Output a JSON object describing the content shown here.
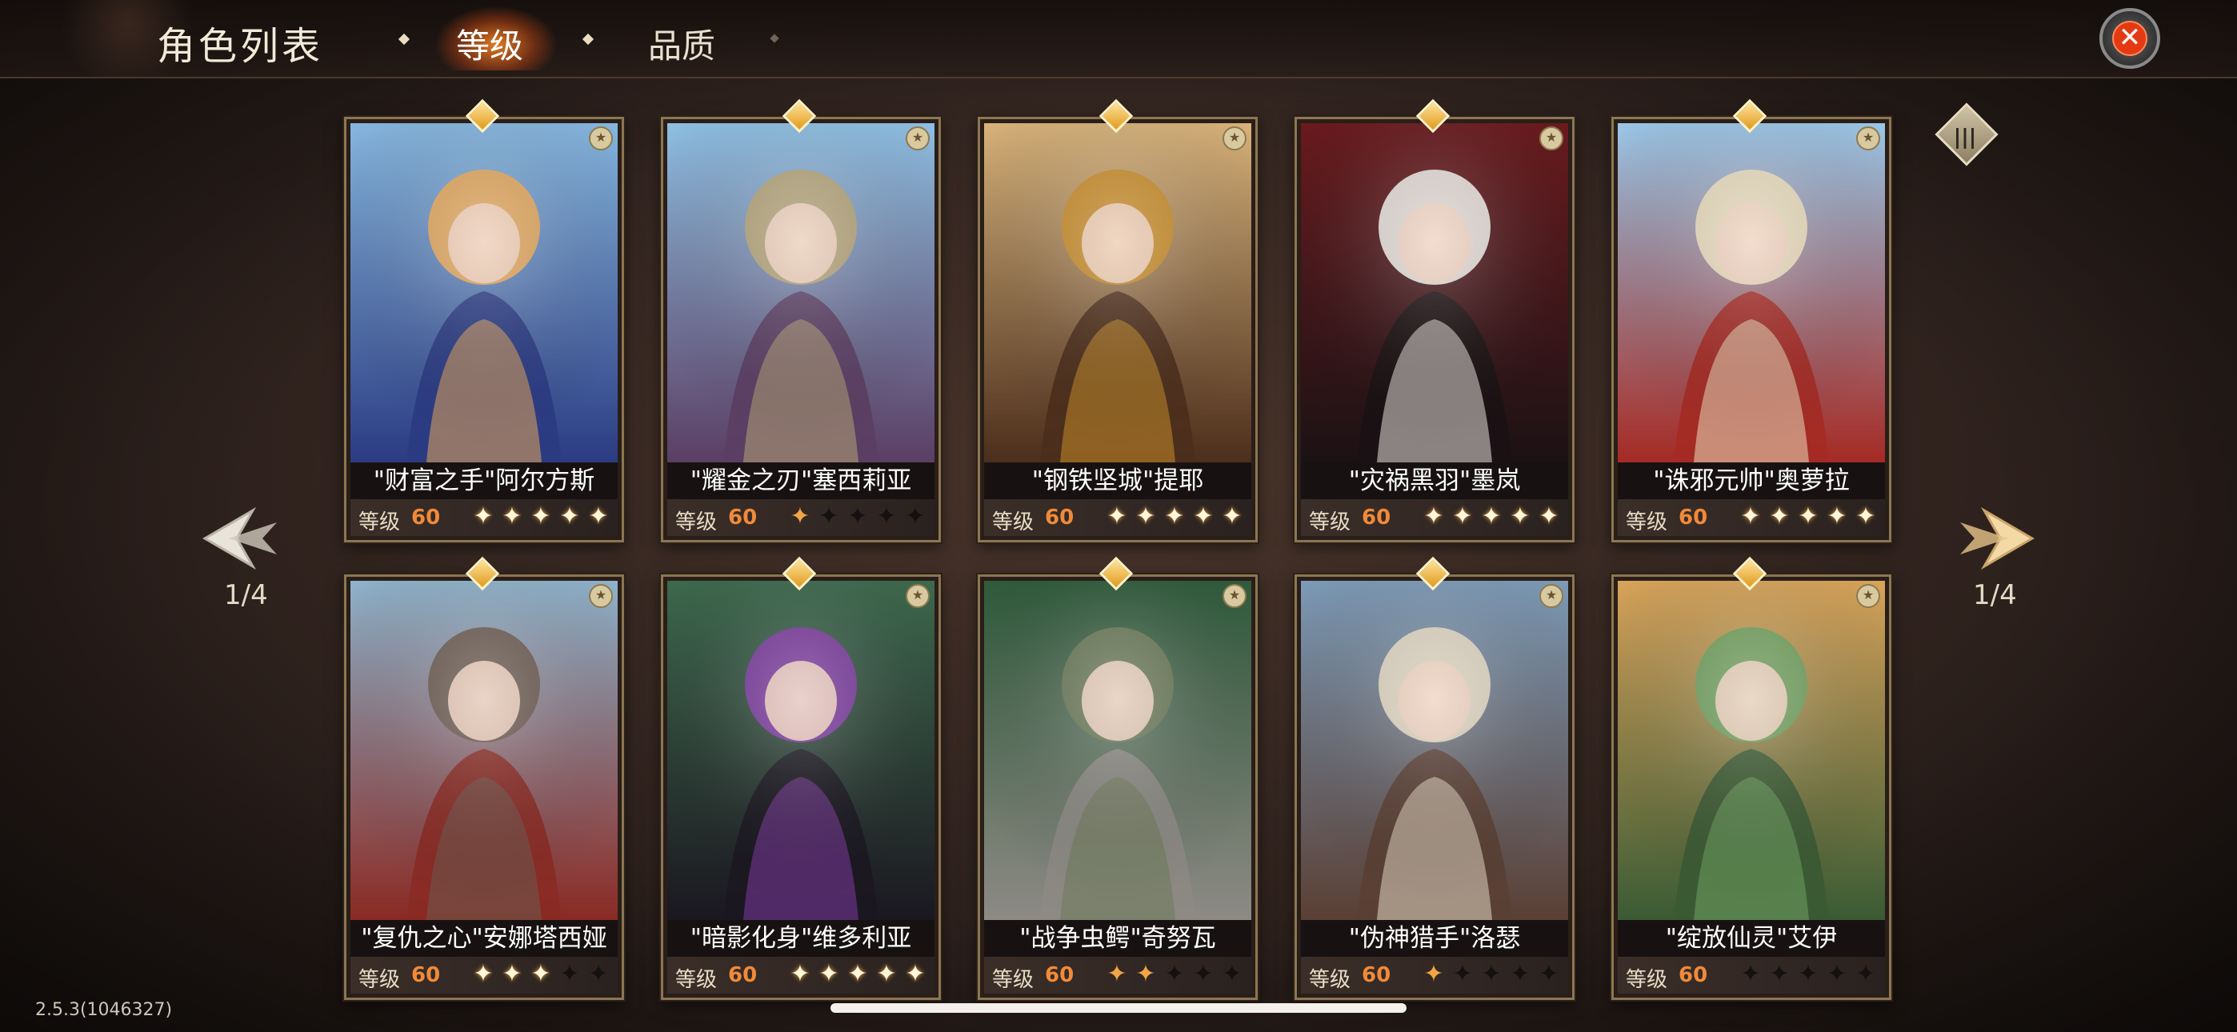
{
  "header": {
    "title": "角色列表",
    "tabs": [
      {
        "label": "等级",
        "active": true
      },
      {
        "label": "品质",
        "active": false
      }
    ]
  },
  "pagination": {
    "left": "1/4",
    "right": "1/4"
  },
  "version": "2.5.3(104632​7)",
  "cards": [
    {
      "name": "\"财富之手\"阿尔方斯",
      "level_label": "等级",
      "level": "60",
      "stars": [
        1,
        1,
        1,
        1,
        1
      ],
      "palette": [
        "#86b7e0",
        "#e5a65a",
        "#2b3b82"
      ]
    },
    {
      "name": "\"耀金之刃\"塞西莉亚",
      "level_label": "等级",
      "level": "60",
      "stars": [
        2,
        0,
        0,
        0,
        0
      ],
      "palette": [
        "#8fc0e4",
        "#b5a377",
        "#5b3e63"
      ]
    },
    {
      "name": "\"钢铁坚城\"提耶",
      "level_label": "等级",
      "level": "60",
      "stars": [
        1,
        1,
        1,
        1,
        1
      ],
      "palette": [
        "#d9b37a",
        "#c78c2a",
        "#4b2e1c"
      ]
    },
    {
      "name": "\"灾祸黑羽\"墨岚",
      "level_label": "等级",
      "level": "60",
      "stars": [
        1,
        1,
        1,
        1,
        1
      ],
      "palette": [
        "#6a1a1e",
        "#e7e1dc",
        "#1b1214"
      ]
    },
    {
      "name": "\"诛邪元帅\"奥萝拉",
      "level_label": "等级",
      "level": "60",
      "stars": [
        1,
        1,
        1,
        1,
        1
      ],
      "palette": [
        "#9bc7e8",
        "#eadcbc",
        "#a52a24"
      ]
    },
    {
      "name": "\"复仇之心\"安娜塔西娅",
      "level_label": "等级",
      "level": "60",
      "stars": [
        1,
        1,
        1,
        0,
        0
      ],
      "palette": [
        "#8fb3cc",
        "#6b5b50",
        "#8a2a24"
      ]
    },
    {
      "name": "\"暗影化身\"维多利亚",
      "level_label": "等级",
      "level": "60",
      "stars": [
        1,
        1,
        1,
        1,
        1
      ],
      "palette": [
        "#3d6a4d",
        "#7d3aa0",
        "#1b1720"
      ]
    },
    {
      "name": "\"战争虫鳄\"奇努瓦",
      "level_label": "等级",
      "level": "60",
      "stars": [
        2,
        2,
        0,
        0,
        0
      ],
      "palette": [
        "#2f5b3b",
        "#6d7a5a",
        "#8d8a84"
      ]
    },
    {
      "name": "\"伪神猎手\"洛瑟",
      "level_label": "等级",
      "level": "60",
      "stars": [
        2,
        0,
        0,
        0,
        0
      ],
      "palette": [
        "#7d9bb8",
        "#e2d7c2",
        "#5a3f34"
      ]
    },
    {
      "name": "\"绽放仙灵\"艾伊",
      "level_label": "等级",
      "level": "60",
      "stars": [
        0,
        0,
        0,
        0,
        0
      ],
      "palette": [
        "#d9a45a",
        "#6fa060",
        "#3a5a34"
      ]
    }
  ]
}
